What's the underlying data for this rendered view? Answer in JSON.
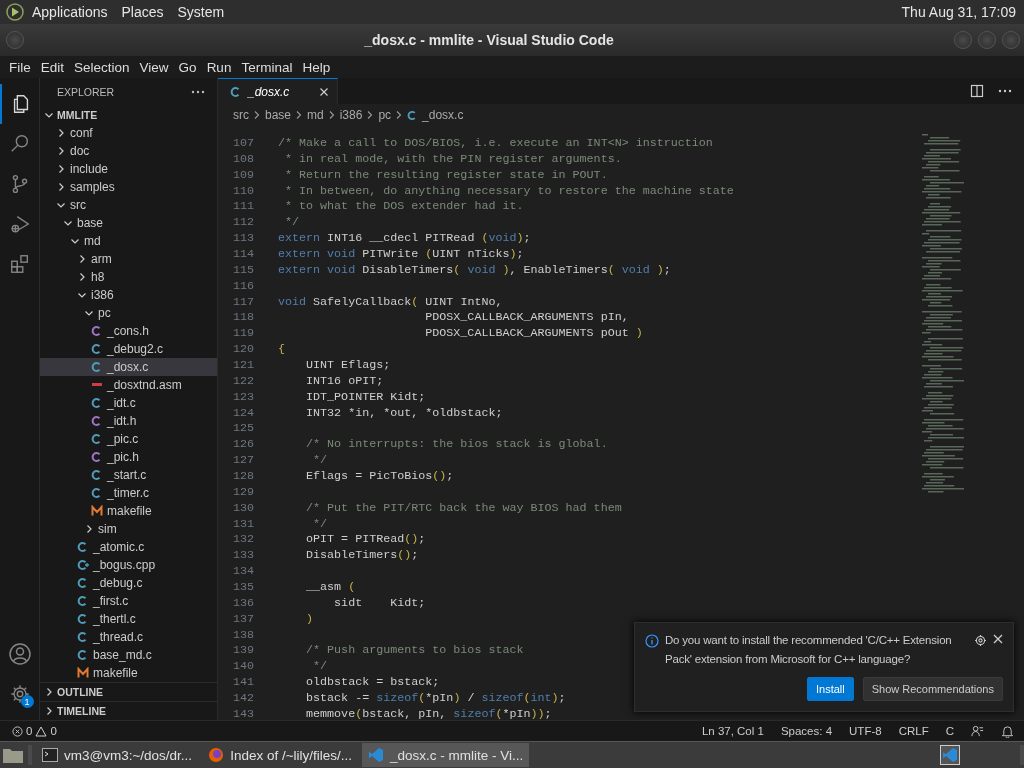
{
  "top_panel": {
    "menus": [
      "Applications",
      "Places",
      "System"
    ],
    "clock": "Thu Aug 31, 17:09"
  },
  "window": {
    "title": "_dosx.c - mmlite - Visual Studio Code"
  },
  "menu_bar": [
    "File",
    "Edit",
    "Selection",
    "View",
    "Go",
    "Run",
    "Terminal",
    "Help"
  ],
  "activity_bar": {
    "settings_badge": "1"
  },
  "explorer": {
    "title": "EXPLORER",
    "root": {
      "label": "MMLITE",
      "expanded": true,
      "children": [
        {
          "label": "conf",
          "kind": "folder",
          "expanded": false,
          "selected": false
        },
        {
          "label": "doc",
          "kind": "folder",
          "expanded": false,
          "selected": false
        },
        {
          "label": "include",
          "kind": "folder",
          "expanded": false,
          "selected": false
        },
        {
          "label": "samples",
          "kind": "folder",
          "expanded": false,
          "selected": false
        },
        {
          "label": "src",
          "kind": "folder",
          "expanded": true,
          "selected": false,
          "children": [
            {
              "label": "base",
              "kind": "folder",
              "expanded": true,
              "selected": false,
              "children": [
                {
                  "label": "md",
                  "kind": "folder",
                  "expanded": true,
                  "selected": false,
                  "children": [
                    {
                      "label": "arm",
                      "kind": "folder",
                      "expanded": false,
                      "selected": false
                    },
                    {
                      "label": "h8",
                      "kind": "folder",
                      "expanded": false,
                      "selected": false
                    },
                    {
                      "label": "i386",
                      "kind": "folder",
                      "expanded": true,
                      "selected": false,
                      "children": [
                        {
                          "label": "pc",
                          "kind": "folder",
                          "expanded": true,
                          "selected": false,
                          "children": [
                            {
                              "label": "_cons.h",
                              "kind": "h",
                              "selected": false
                            },
                            {
                              "label": "_debug2.c",
                              "kind": "c",
                              "selected": false
                            },
                            {
                              "label": "_dosx.c",
                              "kind": "c",
                              "selected": true
                            },
                            {
                              "label": "_dosxtnd.asm",
                              "kind": "asm",
                              "selected": false
                            },
                            {
                              "label": "_idt.c",
                              "kind": "c",
                              "selected": false
                            },
                            {
                              "label": "_idt.h",
                              "kind": "h",
                              "selected": false
                            },
                            {
                              "label": "_pic.c",
                              "kind": "c",
                              "selected": false
                            },
                            {
                              "label": "_pic.h",
                              "kind": "h",
                              "selected": false
                            },
                            {
                              "label": "_start.c",
                              "kind": "c",
                              "selected": false
                            },
                            {
                              "label": "_timer.c",
                              "kind": "c",
                              "selected": false
                            },
                            {
                              "label": "makefile",
                              "kind": "make",
                              "selected": false
                            }
                          ]
                        },
                        {
                          "label": "sim",
                          "kind": "folder",
                          "expanded": false,
                          "selected": false
                        }
                      ]
                    },
                    {
                      "label": "_atomic.c",
                      "kind": "c",
                      "selected": false
                    },
                    {
                      "label": "_bogus.cpp",
                      "kind": "cpp",
                      "selected": false
                    },
                    {
                      "label": "_debug.c",
                      "kind": "c",
                      "selected": false
                    },
                    {
                      "label": "_first.c",
                      "kind": "c",
                      "selected": false
                    },
                    {
                      "label": "_thertl.c",
                      "kind": "c",
                      "selected": false
                    },
                    {
                      "label": "_thread.c",
                      "kind": "c",
                      "selected": false
                    },
                    {
                      "label": "base_md.c",
                      "kind": "c",
                      "selected": false
                    },
                    {
                      "label": "makefile",
                      "kind": "make",
                      "selected": false
                    }
                  ]
                }
              ]
            }
          ]
        }
      ]
    },
    "sections": [
      {
        "label": "OUTLINE",
        "expanded": false
      },
      {
        "label": "TIMELINE",
        "expanded": false
      }
    ]
  },
  "tabs": [
    {
      "label": "_dosx.c",
      "selected": true
    }
  ],
  "breadcrumbs": [
    "src",
    "base",
    "md",
    "i386",
    "pc",
    "_dosx.c"
  ],
  "code": [
    {
      "number": "107",
      "tokens": [
        {
          "kind": "comment",
          "text": "/* Make a call to DOS/BIOS, i.e. execute an INT<N> instruction"
        }
      ]
    },
    {
      "number": "108",
      "tokens": [
        {
          "kind": "comment",
          "text": " * in real mode, with the PIN register arguments."
        }
      ]
    },
    {
      "number": "109",
      "tokens": [
        {
          "kind": "comment",
          "text": " * Return the resulting register state in POUT."
        }
      ]
    },
    {
      "number": "110",
      "tokens": [
        {
          "kind": "comment",
          "text": " * In between, do anything necessary to restore the machine state"
        }
      ]
    },
    {
      "number": "111",
      "tokens": [
        {
          "kind": "comment",
          "text": " * to what the DOS extender had it."
        }
      ]
    },
    {
      "number": "112",
      "tokens": [
        {
          "kind": "comment",
          "text": " */"
        }
      ]
    },
    {
      "number": "113",
      "tokens": [
        {
          "kind": "keyword",
          "text": "extern"
        },
        {
          "kind": "plain",
          "text": " INT16 __cdecl PITRead "
        },
        {
          "kind": "bracket",
          "text": "("
        },
        {
          "kind": "keyword",
          "text": "void"
        },
        {
          "kind": "bracket",
          "text": ")"
        },
        {
          "kind": "plain",
          "text": ";"
        }
      ]
    },
    {
      "number": "114",
      "tokens": [
        {
          "kind": "keyword",
          "text": "extern void"
        },
        {
          "kind": "plain",
          "text": " PITWrite "
        },
        {
          "kind": "bracket",
          "text": "("
        },
        {
          "kind": "plain",
          "text": "UINT nTicks"
        },
        {
          "kind": "bracket",
          "text": ")"
        },
        {
          "kind": "plain",
          "text": ";"
        }
      ]
    },
    {
      "number": "115",
      "tokens": [
        {
          "kind": "keyword",
          "text": "extern void"
        },
        {
          "kind": "plain",
          "text": " DisableTimers"
        },
        {
          "kind": "bracket",
          "text": "("
        },
        {
          "kind": "keyword",
          "text": " void "
        },
        {
          "kind": "bracket",
          "text": ")"
        },
        {
          "kind": "plain",
          "text": ", EnableTimers"
        },
        {
          "kind": "bracket",
          "text": "("
        },
        {
          "kind": "keyword",
          "text": " void "
        },
        {
          "kind": "bracket",
          "text": ")"
        },
        {
          "kind": "plain",
          "text": ";"
        }
      ]
    },
    {
      "number": "116"
    },
    {
      "number": "117",
      "tokens": [
        {
          "kind": "keyword",
          "text": "void"
        },
        {
          "kind": "plain",
          "text": " SafelyCallback"
        },
        {
          "kind": "bracket",
          "text": "("
        },
        {
          "kind": "plain",
          "text": " UINT IntNo,"
        }
      ]
    },
    {
      "number": "118",
      "tokens": [
        {
          "kind": "plain",
          "text": "                     PDOSX_CALLBACK_ARGUMENTS pIn,"
        }
      ]
    },
    {
      "number": "119",
      "tokens": [
        {
          "kind": "plain",
          "text": "                     PDOSX_CALLBACK_ARGUMENTS pOut "
        },
        {
          "kind": "bracket",
          "text": ")"
        }
      ]
    },
    {
      "number": "120",
      "tokens": [
        {
          "kind": "bracket",
          "text": "{"
        }
      ]
    },
    {
      "number": "121",
      "tokens": [
        {
          "kind": "plain",
          "text": "    UINT Eflags;"
        }
      ]
    },
    {
      "number": "122",
      "tokens": [
        {
          "kind": "plain",
          "text": "    INT16 oPIT;"
        }
      ]
    },
    {
      "number": "123",
      "tokens": [
        {
          "kind": "plain",
          "text": "    IDT_POINTER Kidt;"
        }
      ]
    },
    {
      "number": "124",
      "tokens": [
        {
          "kind": "plain",
          "text": "    INT32 *in, *out, *oldbstack;"
        }
      ]
    },
    {
      "number": "125"
    },
    {
      "number": "126",
      "tokens": [
        {
          "kind": "comment",
          "text": "    /* No interrupts: the bios stack is global."
        }
      ]
    },
    {
      "number": "127",
      "tokens": [
        {
          "kind": "comment",
          "text": "     */"
        }
      ]
    },
    {
      "number": "128",
      "tokens": [
        {
          "kind": "plain",
          "text": "    Eflags = PicToBios"
        },
        {
          "kind": "bracket",
          "text": "()"
        },
        {
          "kind": "plain",
          "text": ";"
        }
      ]
    },
    {
      "number": "129"
    },
    {
      "number": "130",
      "tokens": [
        {
          "kind": "comment",
          "text": "    /* Put the PIT/RTC back the way BIOS had them"
        }
      ]
    },
    {
      "number": "131",
      "tokens": [
        {
          "kind": "comment",
          "text": "     */"
        }
      ]
    },
    {
      "number": "132",
      "tokens": [
        {
          "kind": "plain",
          "text": "    oPIT = PITRead"
        },
        {
          "kind": "bracket",
          "text": "()"
        },
        {
          "kind": "plain",
          "text": ";"
        }
      ]
    },
    {
      "number": "133",
      "tokens": [
        {
          "kind": "plain",
          "text": "    DisableTimers"
        },
        {
          "kind": "bracket",
          "text": "()"
        },
        {
          "kind": "plain",
          "text": ";"
        }
      ]
    },
    {
      "number": "134"
    },
    {
      "number": "135",
      "tokens": [
        {
          "kind": "plain",
          "text": "    __asm "
        },
        {
          "kind": "bracket",
          "text": "("
        }
      ]
    },
    {
      "number": "136",
      "tokens": [
        {
          "kind": "plain",
          "text": "        sidt    Kidt;"
        }
      ]
    },
    {
      "number": "137",
      "tokens": [
        {
          "kind": "bracket",
          "text": "    )"
        }
      ]
    },
    {
      "number": "138"
    },
    {
      "number": "139",
      "tokens": [
        {
          "kind": "comment",
          "text": "    /* Push arguments to bios stack"
        }
      ]
    },
    {
      "number": "140",
      "tokens": [
        {
          "kind": "comment",
          "text": "     */"
        }
      ]
    },
    {
      "number": "141",
      "tokens": [
        {
          "kind": "plain",
          "text": "    oldbstack = bstack;"
        }
      ]
    },
    {
      "number": "142",
      "tokens": [
        {
          "kind": "plain",
          "text": "    bstack -= "
        },
        {
          "kind": "keyword",
          "text": "sizeof"
        },
        {
          "kind": "bracket",
          "text": "("
        },
        {
          "kind": "plain",
          "text": "*pIn"
        },
        {
          "kind": "bracket",
          "text": ")"
        },
        {
          "kind": "plain",
          "text": " / "
        },
        {
          "kind": "keyword",
          "text": "sizeof"
        },
        {
          "kind": "bracket",
          "text": "("
        },
        {
          "kind": "keyword",
          "text": "int"
        },
        {
          "kind": "bracket",
          "text": ")"
        },
        {
          "kind": "plain",
          "text": ";"
        }
      ]
    },
    {
      "number": "143",
      "tokens": [
        {
          "kind": "plain",
          "text": "    memmove"
        },
        {
          "kind": "bracket",
          "text": "("
        },
        {
          "kind": "plain",
          "text": "bstack, pIn, "
        },
        {
          "kind": "keyword",
          "text": "sizeof"
        },
        {
          "kind": "bracket",
          "text": "("
        },
        {
          "kind": "plain",
          "text": "*pIn"
        },
        {
          "kind": "bracket",
          "text": "))"
        },
        {
          "kind": "plain",
          "text": ";"
        }
      ]
    }
  ],
  "notification": {
    "message": "Do you want to install the recommended 'C/C++ Extension Pack' extension from Microsoft for C++ language?",
    "buttons": [
      {
        "label": "Install",
        "kind": "primary"
      },
      {
        "label": "Show Recommendations",
        "kind": "secondary"
      }
    ]
  },
  "status_bar": {
    "errors": "0",
    "warnings": "0",
    "items": [
      "Ln 37, Col 1",
      "Spaces: 4",
      "UTF-8",
      "CRLF",
      "C"
    ]
  },
  "taskbar": {
    "tasks": [
      {
        "label": "vm3@vm3:~/dos/dr...",
        "kind": "terminal",
        "selected": false
      },
      {
        "label": "Index of /~lily/files/...",
        "kind": "browser",
        "selected": false
      },
      {
        "label": "_dosx.c - mmlite - Vi...",
        "kind": "editor",
        "selected": true
      }
    ]
  }
}
